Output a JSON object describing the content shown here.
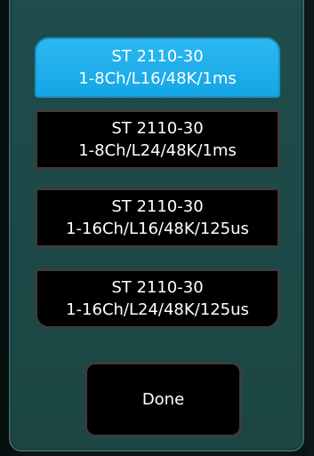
{
  "dialog": {
    "options": [
      {
        "line1": "ST 2110-30",
        "line2": "1-8Ch/L16/48K/1ms",
        "selected": true
      },
      {
        "line1": "ST 2110-30",
        "line2": "1-8Ch/L24/48K/1ms",
        "selected": false
      },
      {
        "line1": "ST 2110-30",
        "line2": "1-16Ch/L16/48K/125us",
        "selected": false
      },
      {
        "line1": "ST 2110-30",
        "line2": "1-16Ch/L24/48K/125us",
        "selected": false
      }
    ],
    "done_label": "Done"
  },
  "colors": {
    "panel": "#1d4a48",
    "selected": "#1aace8",
    "button": "#000000",
    "button_border": "#3c3c3c"
  }
}
